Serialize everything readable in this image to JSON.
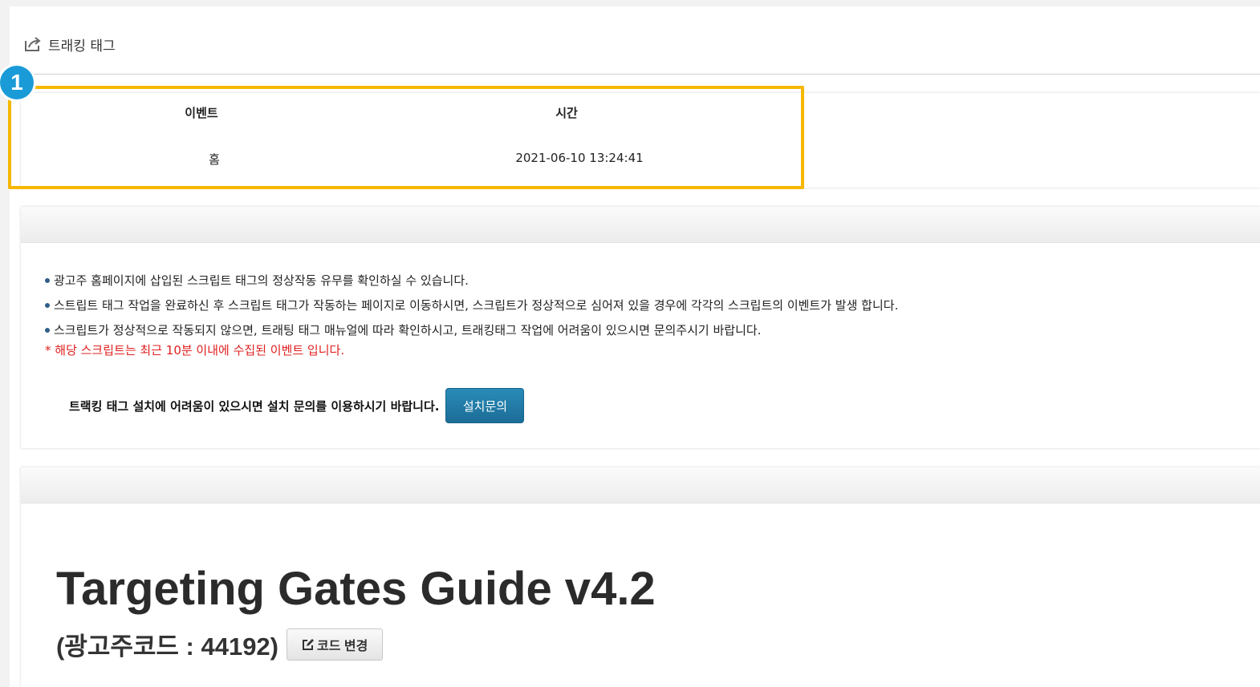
{
  "page": {
    "title": "트래킹 태그"
  },
  "events": {
    "step_badge": "1",
    "columns": [
      "이벤트",
      "시간"
    ],
    "rows": [
      {
        "event": "홈",
        "time": "2021-06-10 13:24:41"
      }
    ]
  },
  "info": {
    "items": [
      "광고주 홈페이지에 삽입된 스크립트 태그의 정상작동 유무를 확인하실 수 있습니다.",
      "스트립트 태그 작업을 완료하신 후 스크립트 태그가 작동하는 페이지로 이동하시면, 스크립트가 정상적으로 심어져 있을 경우에 각각의 스크립트의 이벤트가 발생 합니다.",
      "스크립트가 정상적으로 작동되지 않으면, 트래팅 태그 매뉴얼에 따라 확인하시고, 트래킹태그 작업에 어려움이 있으시면 문의주시기 바랍니다."
    ],
    "warning": "* 해당 스크립트는 최근 10분 이내에 수집된 이벤트 입니다.",
    "install_text": "트랙킹 태그 설치에 어려움이 있으시면 설치 문의를 이용하시기 바랍니다.",
    "install_button": "설치문의"
  },
  "guide": {
    "title": "Targeting Gates Guide v4.2",
    "advertiser_code": "(광고주코드 : 44192)",
    "change_code_button": "코드 변경"
  },
  "colors": {
    "highlight": "#f5b700",
    "badge": "#1a9bd7",
    "warning": "#e02020",
    "primary_button": "#1f7aa8"
  }
}
